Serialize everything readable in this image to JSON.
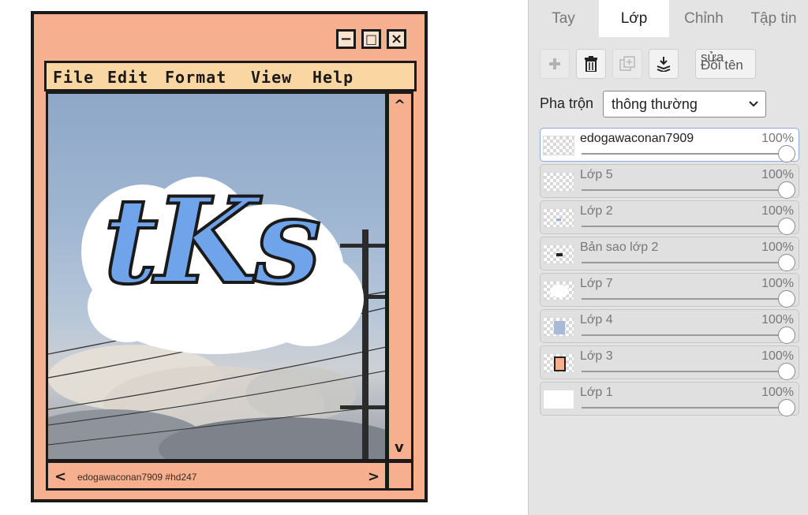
{
  "artwork": {
    "menu": [
      "File",
      "Edit",
      "Format",
      "View",
      "Help"
    ],
    "window_buttons": {
      "minimize": "−",
      "maximize": "□",
      "close": "×"
    },
    "scroll_up": "^",
    "scroll_down": "v",
    "scroll_left": "<",
    "scroll_right": ">",
    "caption": "edogawaconan7909  #hd247",
    "logo_text": "tKs",
    "colors": {
      "frame": "#f6b08f",
      "menubar": "#fad6a3",
      "outline": "#1a1a1a",
      "sky": "#9fb6d2",
      "logo_blue": "#6fa3ea"
    }
  },
  "panel": {
    "tabs": [
      {
        "label": "Tay"
      },
      {
        "label": "Lớp",
        "active": true
      },
      {
        "label": "Chỉnh"
      },
      {
        "label": "Tập tin"
      }
    ],
    "toolbar": {
      "add_icon": "plus-icon",
      "delete_icon": "trash-icon",
      "duplicate_icon": "duplicate-icon",
      "merge_icon": "merge-down-icon",
      "rename_line1": "sửa",
      "rename_line2": "Đổi tên"
    },
    "blend": {
      "label": "Pha trộn",
      "value": "thông thường"
    },
    "layers": [
      {
        "name": "edogawaconan7909",
        "opacity": "100%",
        "selected": true
      },
      {
        "name": "Lớp 5",
        "opacity": "100%"
      },
      {
        "name": "Lớp 2",
        "opacity": "100%"
      },
      {
        "name": "Bản sao lớp 2",
        "opacity": "100%"
      },
      {
        "name": "Lớp 7",
        "opacity": "100%"
      },
      {
        "name": "Lớp 4",
        "opacity": "100%"
      },
      {
        "name": "Lớp 3",
        "opacity": "100%"
      },
      {
        "name": "Lớp 1",
        "opacity": "100%"
      }
    ]
  }
}
